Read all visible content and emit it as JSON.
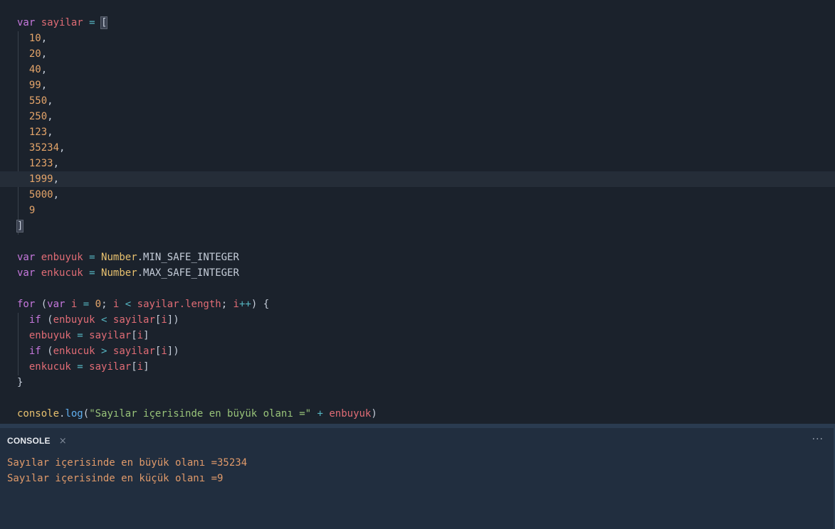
{
  "editor": {
    "line1": {
      "kw": "var",
      "name": "sayilar",
      "eq": " = ",
      "open": "["
    },
    "numbers": [
      "10",
      "20",
      "40",
      "99",
      "550",
      "250",
      "123",
      "35234",
      "1233",
      "1999",
      "5000",
      "9"
    ],
    "close": "]",
    "line_enbuyuk": {
      "kw": "var",
      "name": "enbuyuk",
      "eq": " = ",
      "cls": "Number",
      "prop": ".MIN_SAFE_INTEGER"
    },
    "line_enkucuk": {
      "kw": "var",
      "name": "enkucuk",
      "eq": " = ",
      "cls": "Number",
      "prop": ".MAX_SAFE_INTEGER"
    },
    "for_line": {
      "kw_for": "for",
      "p1": " (",
      "kw_var": "var",
      "i1": "i",
      "eq": " = ",
      "zero": "0",
      "semi1": "; ",
      "i2": "i",
      "lt": " < ",
      "arr": "sayilar",
      "len": ".length",
      "semi2": "; ",
      "i3": "i",
      "inc": "++",
      "close": ") {"
    },
    "if1": {
      "kw": "if",
      "open": " (",
      "a": "enbuyuk",
      "op": " < ",
      "arr": "sayilar",
      "b1": "[",
      "idx": "i",
      "b2": "])"
    },
    "assign1": {
      "a": "enbuyuk",
      "eq": " = ",
      "arr": "sayilar",
      "b1": "[",
      "idx": "i",
      "b2": "]"
    },
    "if2": {
      "kw": "if",
      "open": " (",
      "a": "enkucuk",
      "op": " > ",
      "arr": "sayilar",
      "b1": "[",
      "idx": "i",
      "b2": "])"
    },
    "assign2": {
      "a": "enkucuk",
      "eq": " = ",
      "arr": "sayilar",
      "b1": "[",
      "idx": "i",
      "b2": "]"
    },
    "brace_close": "}",
    "log_line": {
      "obj": "console",
      "dot": ".",
      "fn": "log",
      "open": "(",
      "str": "\"Sayılar içerisinde en büyük olanı =\"",
      "plus": " + ",
      "arg": "enbuyuk",
      "close": ")"
    }
  },
  "console": {
    "title": "CONSOLE",
    "close_icon": "×",
    "more_icon": "···",
    "output": [
      "Sayılar içerisinde en büyük olanı =35234",
      "Sayılar içerisinde en küçük olanı =9"
    ]
  },
  "colors": {
    "editor_bg": "#1b222c",
    "console_bg": "#212e3f",
    "keyword": "#c678dd",
    "variable": "#e06c75",
    "number": "#e5a56a",
    "class": "#e8c16f",
    "function": "#61afef",
    "string": "#98c379",
    "console_output": "#e09a6a"
  }
}
